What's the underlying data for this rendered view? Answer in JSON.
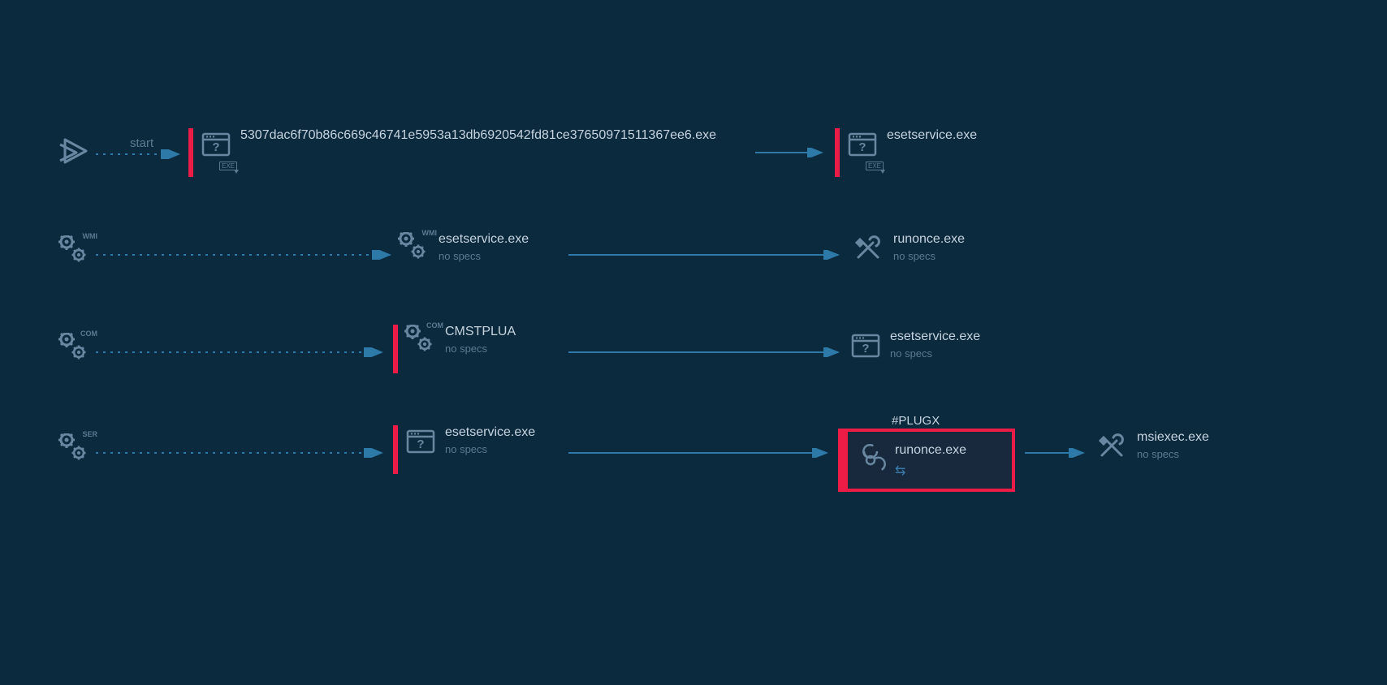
{
  "colors": {
    "bg": "#0c2a3d",
    "accent": "#ed1c47",
    "icon": "#6887a0",
    "text": "#c5d4e0",
    "muted": "#5a7a92",
    "arrow": "#2d7aa8"
  },
  "edges": {
    "start_label": "start"
  },
  "diagram": {
    "row1": {
      "play_icon": "play-triangle",
      "node1": {
        "name": "5307dac6f70b86c669c46741e5953a13db6920542fd81ce37650971511367ee6.exe",
        "badge": "EXE"
      },
      "node2": {
        "name": "esetservice.exe",
        "badge": "EXE"
      }
    },
    "row2": {
      "gear_label": "WMI",
      "node1": {
        "name": "esetservice.exe",
        "sub": "no specs",
        "gear_label": "WMI"
      },
      "node2": {
        "name": "runonce.exe",
        "sub": "no specs"
      }
    },
    "row3": {
      "gear_label": "COM",
      "node1": {
        "name": "CMSTPLUA",
        "sub": "no specs",
        "gear_label": "COM"
      },
      "node2": {
        "name": "esetservice.exe",
        "sub": "no specs"
      }
    },
    "row4": {
      "gear_label": "SER",
      "node1": {
        "name": "esetservice.exe",
        "sub": "no specs"
      },
      "node2": {
        "name": "runonce.exe",
        "tag": "#PLUGX"
      },
      "node3": {
        "name": "msiexec.exe",
        "sub": "no specs"
      }
    }
  }
}
